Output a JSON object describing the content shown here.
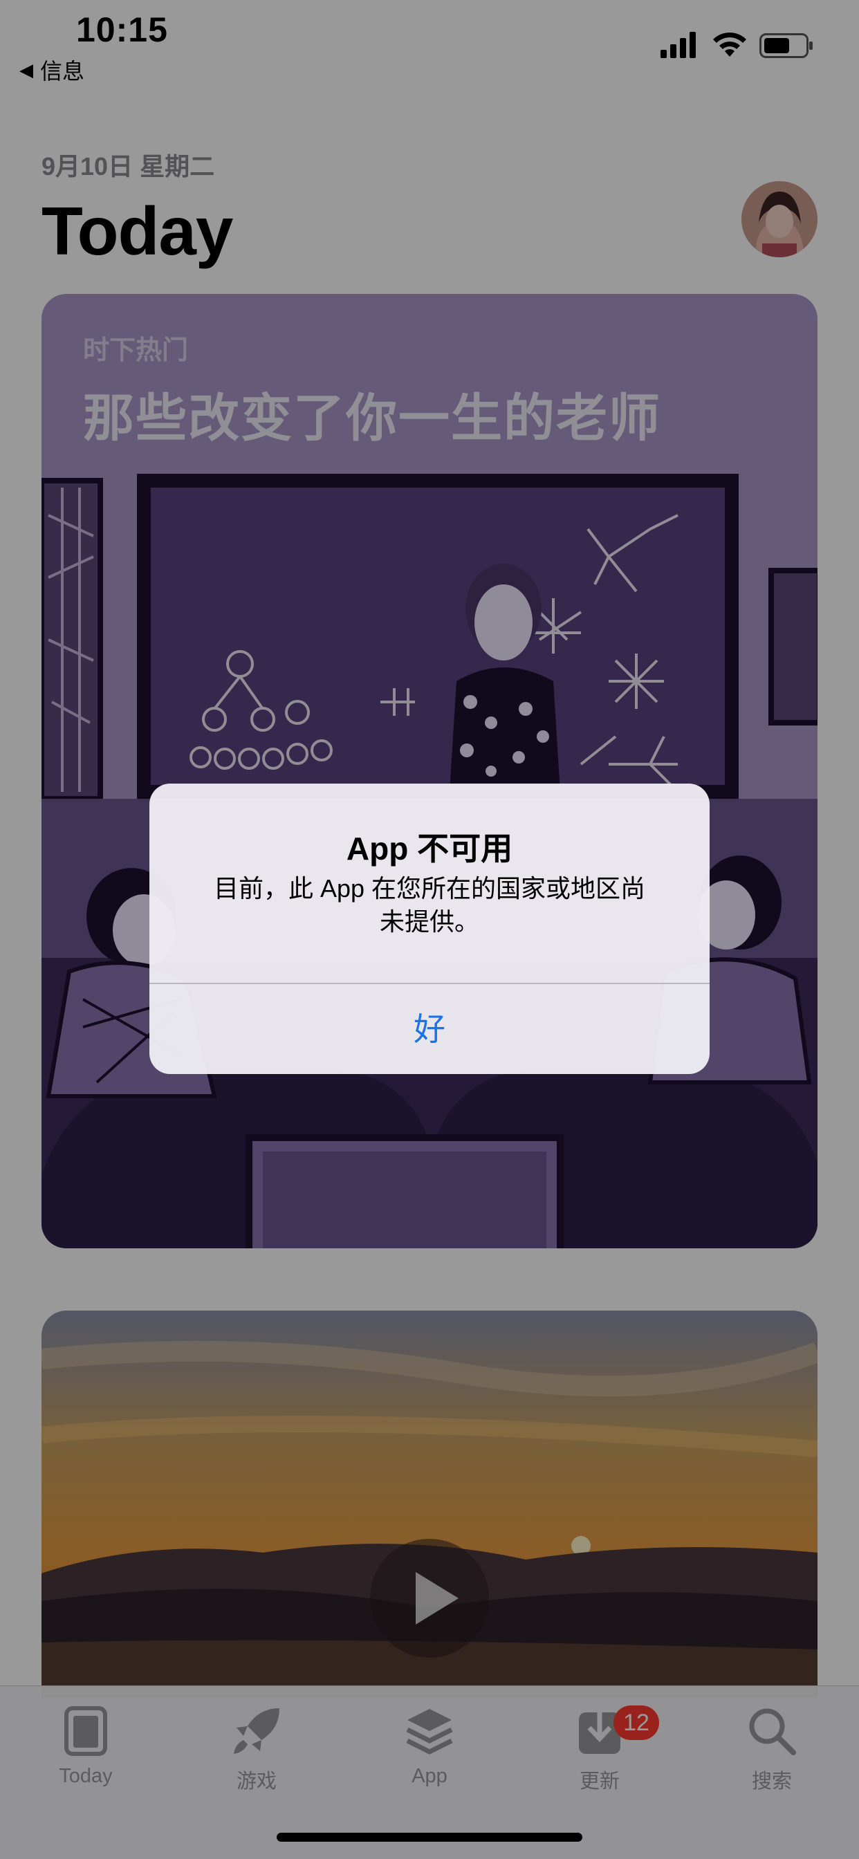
{
  "status_bar": {
    "time": "10:15",
    "back_label": "信息"
  },
  "header": {
    "date": "9月10日 星期二",
    "title": "Today"
  },
  "card1": {
    "kicker": "时下热门",
    "headline": "那些改变了你一生的老师"
  },
  "tabs": [
    {
      "label": "Today",
      "icon": "today-icon"
    },
    {
      "label": "游戏",
      "icon": "rocket-icon"
    },
    {
      "label": "App",
      "icon": "app-stack-icon"
    },
    {
      "label": "更新",
      "icon": "download-icon",
      "badge": "12"
    },
    {
      "label": "搜索",
      "icon": "search-icon"
    }
  ],
  "alert": {
    "title": "App 不可用",
    "message_line1": "目前，此 App 在您所在的国家或地区尚",
    "message_line2": "未提供。",
    "button": "好"
  },
  "colors": {
    "accent": "#1a73e8",
    "badge": "#ff3b30",
    "card1_bg": "#a898c8"
  }
}
